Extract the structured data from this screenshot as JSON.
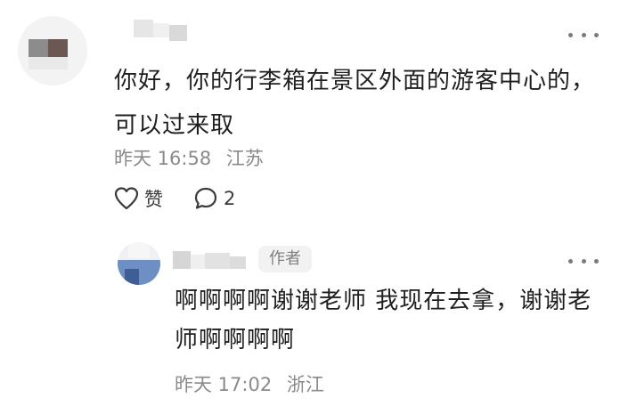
{
  "comment": {
    "text": "你好，你的行李箱在景区外面的游客中心的，可以过来取",
    "time": "昨天 16:58",
    "location": "江苏",
    "like_label": "赞",
    "reply_count": "2",
    "more_icon": "more-dots-icon",
    "like_icon": "heart-outline-icon",
    "reply_icon": "comment-bubble-icon"
  },
  "reply": {
    "badge": "作者",
    "text": "啊啊啊啊谢谢老师 我现在去拿，谢谢老师啊啊啊啊",
    "time": "昨天 17:02",
    "location": "浙江",
    "more_icon": "more-dots-icon"
  },
  "colors": {
    "text_primary": "#1f1f1f",
    "text_meta": "#8a8a8a",
    "badge_bg": "#f2f2f2",
    "badge_text": "#808080"
  }
}
